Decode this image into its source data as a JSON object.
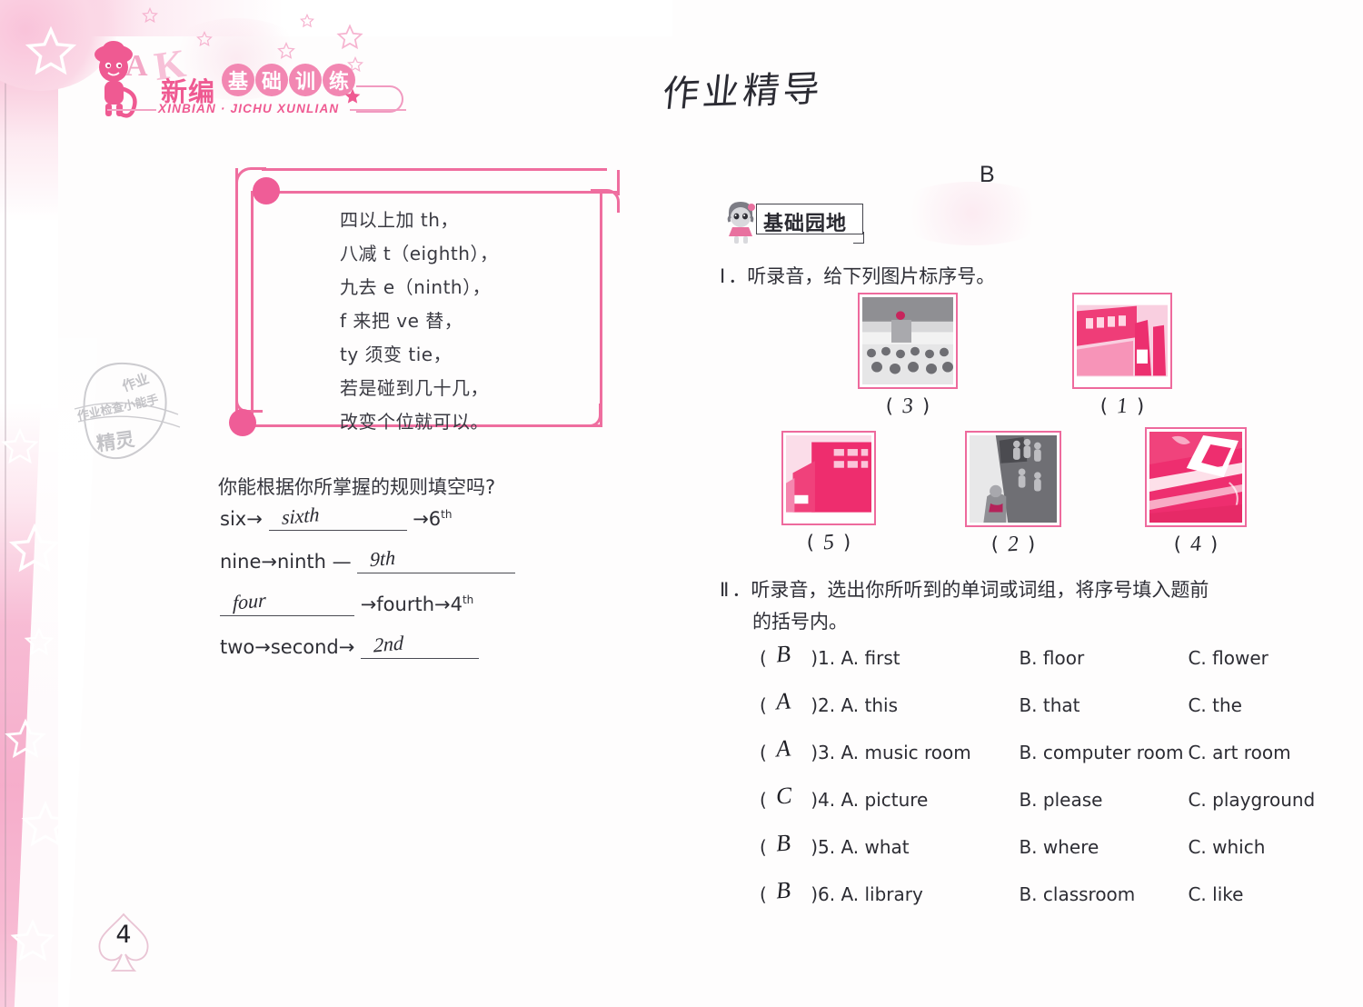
{
  "logo": {
    "cn_title": "新编",
    "bubble_chars": [
      "基",
      "础",
      "训",
      "练"
    ],
    "pinyin": "XINBIAN · JICHU XUNLIAN",
    "deco_letter_a": "A",
    "deco_letter_k": "K"
  },
  "header": {
    "handwritten_title": "作业精导"
  },
  "stamp": {
    "line1": "作业",
    "line2": "作业检查小能手",
    "line3": "精灵"
  },
  "rules_box": {
    "lines": [
      "四以上加 th，",
      "八减 t（eighth），",
      "九去 e（ninth），",
      "f 来把 ve 替，",
      "ty 须变 tie，",
      "若是碰到几十几，",
      "改变个位就可以。"
    ]
  },
  "exercise": {
    "prompt": "你能根据你所掌握的规则填空吗?",
    "rows": [
      {
        "pre": "six→",
        "blank_written": "sixth",
        "post": "→6",
        "post_sup": "th",
        "blank_first": false
      },
      {
        "pre": "nine→ninth —",
        "blank_written": "9th",
        "post": "",
        "post_sup": "",
        "blank_first": false
      },
      {
        "pre": "",
        "blank_written": "four",
        "post": "→fourth→4",
        "post_sup": "th",
        "blank_first": true
      },
      {
        "pre": "two→second→",
        "blank_written": "2nd",
        "post": "",
        "post_sup": "",
        "blank_first": false
      }
    ]
  },
  "page_number": "4",
  "right": {
    "section_letter": "B",
    "badge_label": "基础园地",
    "section1": {
      "numeral": "Ⅰ",
      "text": "．听录音，给下列图片标序号。",
      "pictures": [
        {
          "answer": "3",
          "alt": "stage-with-audience-photo"
        },
        {
          "answer": "1",
          "alt": "classroom-interior-photo"
        },
        {
          "answer": "5",
          "alt": "school-building-photo"
        },
        {
          "answer": "2",
          "alt": "students-on-steps-photo"
        },
        {
          "answer": "4",
          "alt": "playground-track-photo"
        }
      ]
    },
    "section2": {
      "numeral": "Ⅱ",
      "text_line1": "．听录音，选出你所听到的单词或词组，将序号填入题前",
      "text_line2": "的括号内。",
      "items": [
        {
          "answer": "B",
          "num": "1.",
          "a": "A. first",
          "b": "B. floor",
          "c": "C. flower"
        },
        {
          "answer": "A",
          "num": "2.",
          "a": "A. this",
          "b": "B. that",
          "c": "C. the"
        },
        {
          "answer": "A",
          "num": "3.",
          "a": "A. music room",
          "b": "B. computer room",
          "c": "C. art room"
        },
        {
          "answer": "C",
          "num": "4.",
          "a": "A. picture",
          "b": "B. please",
          "c": "C. playground"
        },
        {
          "answer": "B",
          "num": "5.",
          "a": "A. what",
          "b": "B. where",
          "c": "C. which"
        },
        {
          "answer": "B",
          "num": "6.",
          "a": "A. library",
          "b": "B. classroom",
          "c": "C. like"
        }
      ]
    }
  },
  "colors": {
    "pink_primary": "#ef6e9f",
    "pink_logo": "#ef5a92",
    "pink_light": "#f7b8d2",
    "frame_pink": "#ee6a9d",
    "ink": "#2c2c33"
  }
}
